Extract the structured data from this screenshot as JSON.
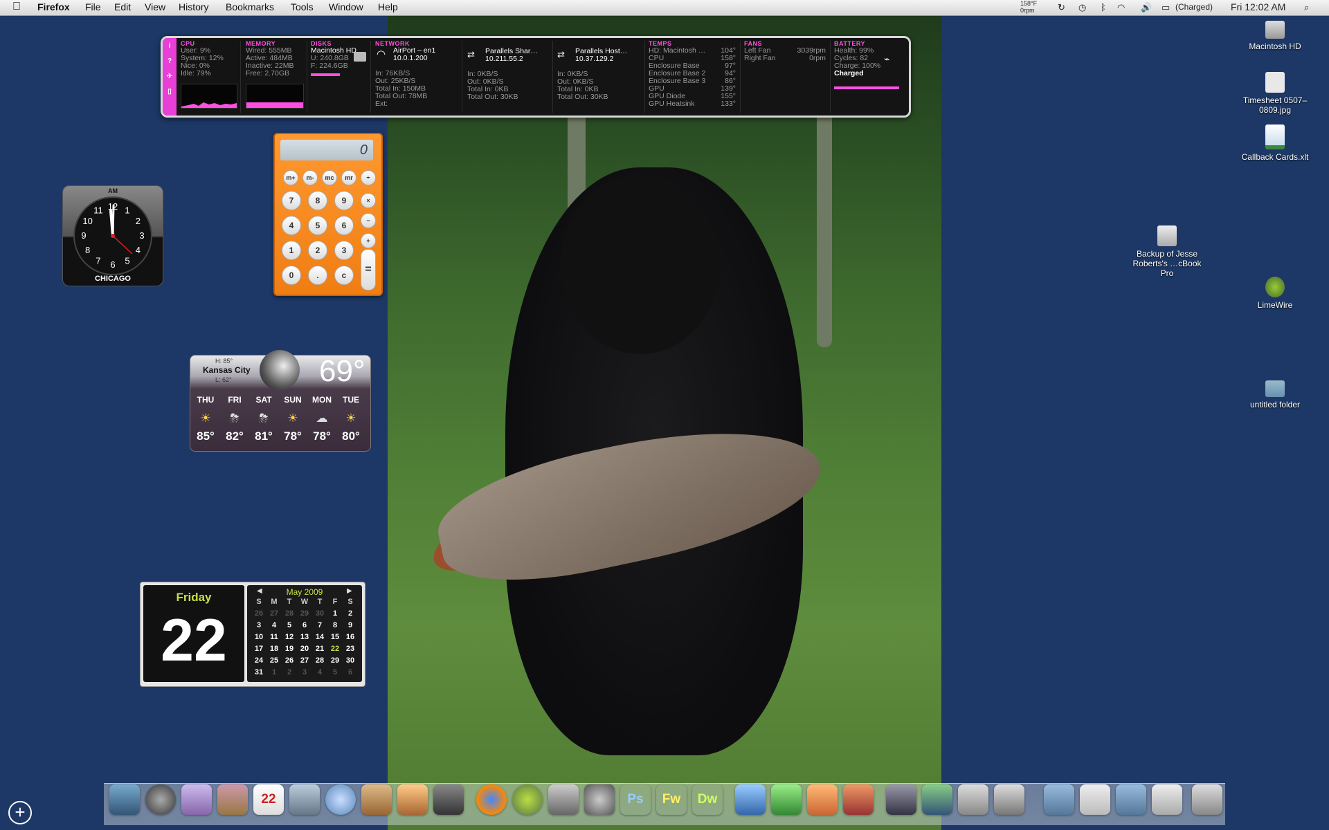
{
  "menubar": {
    "app": "Firefox",
    "items": [
      "File",
      "Edit",
      "View",
      "History",
      "Bookmarks",
      "Tools",
      "Window",
      "Help"
    ],
    "temp_small": "158°F",
    "rpm_small": "0rpm",
    "battery": "(Charged)",
    "clock": "Fri 12:02 AM"
  },
  "istat": {
    "cpu": {
      "title": "CPU",
      "user": "User: 9%",
      "system": "System: 12%",
      "nice": "Nice: 0%",
      "idle": "Idle: 79%"
    },
    "memory": {
      "title": "MEMORY",
      "wired": "Wired: 555MB",
      "active": "Active: 484MB",
      "inactive": "Inactive: 22MB",
      "free": "Free: 2.70GB"
    },
    "disks": {
      "title": "DISKS",
      "name": "Macintosh HD",
      "used": "U: 240.8GB",
      "free": "F: 224.6GB"
    },
    "network": {
      "title": "NETWORK",
      "airport": {
        "name": "AirPort – en1",
        "ip": "10.0.1.200",
        "in": "In: 76KB/S",
        "out": "Out: 25KB/S",
        "total_in": "Total In: 150MB",
        "total_out": "Total Out: 78MB",
        "ext": "Ext:"
      },
      "shared": {
        "name": "Parallels Shar…",
        "ip": "10.211.55.2",
        "in": "In: 0KB/S",
        "out": "Out: 0KB/S",
        "total_in": "Total In: 0KB",
        "total_out": "Total Out: 30KB"
      },
      "host": {
        "name": "Parallels Host…",
        "ip": "10.37.129.2",
        "in": "In: 0KB/S",
        "out": "Out: 0KB/S",
        "total_in": "Total In: 0KB",
        "total_out": "Total Out: 30KB"
      }
    },
    "temps": {
      "title": "TEMPS",
      "rows": [
        {
          "label": "HD: Macintosh …",
          "value": "104°"
        },
        {
          "label": "CPU",
          "value": "158°"
        },
        {
          "label": "Enclosure Base",
          "value": "97°"
        },
        {
          "label": "Enclosure Base 2",
          "value": "94°"
        },
        {
          "label": "Enclosure Base 3",
          "value": "86°"
        },
        {
          "label": "GPU",
          "value": "139°"
        },
        {
          "label": "GPU Diode",
          "value": "155°"
        },
        {
          "label": "GPU Heatsink",
          "value": "133°"
        }
      ]
    },
    "fans": {
      "title": "FANS",
      "left_label": "Left Fan",
      "left_value": "3039rpm",
      "right_label": "Right Fan",
      "right_value": "0rpm"
    },
    "battery": {
      "title": "BATTERY",
      "health": "Health: 99%",
      "cycles": "Cycles: 82",
      "charge": "Charge: 100%",
      "status": "Charged"
    }
  },
  "calculator": {
    "display": "0",
    "keys_top": [
      "m+",
      "m-",
      "mc",
      "mr",
      "÷"
    ],
    "rows": [
      [
        "7",
        "8",
        "9",
        "×"
      ],
      [
        "4",
        "5",
        "6",
        "−"
      ],
      [
        "1",
        "2",
        "3",
        "+"
      ],
      [
        "0",
        ".",
        "c",
        "="
      ]
    ]
  },
  "clock_widget": {
    "ampm": "AM",
    "city": "CHICAGO",
    "numbers": [
      "12",
      "1",
      "2",
      "3",
      "4",
      "5",
      "6",
      "7",
      "8",
      "9",
      "10",
      "11"
    ]
  },
  "weather": {
    "high": "H: 85°",
    "city": "Kansas City",
    "low": "L: 62°",
    "current": "69°",
    "days": [
      {
        "day": "THU",
        "temp": "85°",
        "icon": "sun-icon"
      },
      {
        "day": "FRI",
        "temp": "82°",
        "icon": "storm-icon"
      },
      {
        "day": "SAT",
        "temp": "81°",
        "icon": "storm-icon"
      },
      {
        "day": "SUN",
        "temp": "78°",
        "icon": "sun-icon"
      },
      {
        "day": "MON",
        "temp": "78°",
        "icon": "cloud-icon"
      },
      {
        "day": "TUE",
        "temp": "80°",
        "icon": "sun-icon"
      }
    ]
  },
  "calendar": {
    "weekday": "Friday",
    "day": "22",
    "month": "May 2009",
    "headers": [
      "S",
      "M",
      "T",
      "W",
      "T",
      "F",
      "S"
    ],
    "weeks": [
      [
        "26",
        "27",
        "28",
        "29",
        "30",
        "1",
        "2"
      ],
      [
        "3",
        "4",
        "5",
        "6",
        "7",
        "8",
        "9"
      ],
      [
        "10",
        "11",
        "12",
        "13",
        "14",
        "15",
        "16"
      ],
      [
        "17",
        "18",
        "19",
        "20",
        "21",
        "22",
        "23"
      ],
      [
        "24",
        "25",
        "26",
        "27",
        "28",
        "29",
        "30"
      ],
      [
        "31",
        "1",
        "2",
        "3",
        "4",
        "5",
        "6"
      ]
    ]
  },
  "desktop_icons": [
    {
      "label": "Macintosh HD",
      "icon": "hard-drive-icon"
    },
    {
      "label": "Timesheet 0507–0809.jpg",
      "icon": "image-file-icon"
    },
    {
      "label": "Callback Cards.xlt",
      "icon": "excel-file-icon"
    },
    {
      "label": "Backup of Jesse Roberts's …cBook Pro",
      "icon": "drive-icon"
    },
    {
      "label": "LimeWire",
      "icon": "limewire-icon"
    },
    {
      "label": "untitled folder",
      "icon": "folder-icon"
    }
  ],
  "dock": {
    "labeled": [
      "Ps",
      "Fw",
      "Dw"
    ],
    "colors": {
      "ps": "#2a4a87",
      "fw": "#8a7a1a",
      "dw": "#4a6a1a"
    }
  }
}
